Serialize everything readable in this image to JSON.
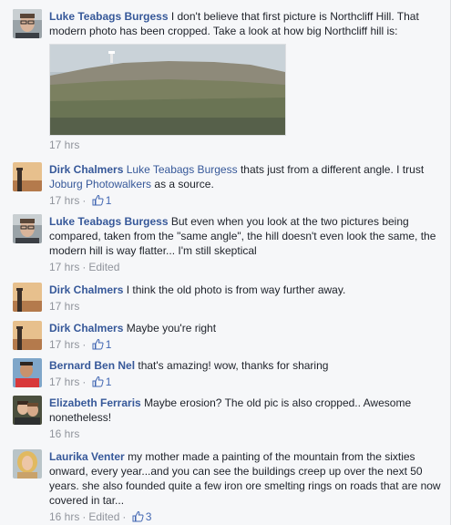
{
  "comments": [
    {
      "author": "Luke Teabags Burgess",
      "text": "I don't believe that first picture is Northcliff Hill. That modern photo has been cropped. Take a look at how big Northcliff hill is:",
      "time": "17 hrs",
      "avatar_icon": "man-with-glasses-avatar"
    },
    {
      "author": "Dirk Chalmers",
      "mention": "Luke Teabags Burgess",
      "text_a": "thats just from a different angle. I trust",
      "mention2": "Joburg Photowalkers",
      "text_b": "as a source.",
      "time": "17 hrs",
      "likes": "1",
      "avatar_icon": "sunset-tower-avatar"
    },
    {
      "author": "Luke Teabags Burgess",
      "text": "But even when you look at the two pictures being compared, taken from the \"same angle\", the hill doesn't even look the same, the modern hill is way flatter... I'm still skeptical",
      "time": "17 hrs",
      "edited": "Edited",
      "avatar_icon": "man-with-glasses-avatar"
    },
    {
      "author": "Dirk Chalmers",
      "text": "I think the old photo is from way further away.",
      "time": "17 hrs",
      "avatar_icon": "sunset-tower-avatar"
    },
    {
      "author": "Dirk Chalmers",
      "text": "Maybe you're right",
      "time": "17 hrs",
      "likes": "1",
      "avatar_icon": "sunset-tower-avatar"
    },
    {
      "author": "Bernard Ben Nel",
      "text": "that's amazing! wow, thanks for sharing",
      "time": "17 hrs",
      "likes": "1",
      "avatar_icon": "man-red-shirt-avatar"
    },
    {
      "author": "Elizabeth Ferraris",
      "text": "Maybe erosion? The old pic is also cropped.. Awesome nonetheless!",
      "time": "16 hrs",
      "avatar_icon": "couple-avatar"
    },
    {
      "author": "Laurika Venter",
      "text": "my mother made a painting of the mountain from the sixties onward, every year...and you can see the buildings creep up over the next 50 years. she also founded quite a few iron ore smelting rings on roads that are now covered in tar...",
      "time": "16 hrs",
      "edited": "Edited",
      "likes": "3",
      "avatar_icon": "blonde-woman-avatar"
    }
  ],
  "colors": {
    "link": "#365899",
    "meta": "#90949c",
    "like": "#4267b2",
    "background": "#f6f7f9"
  }
}
